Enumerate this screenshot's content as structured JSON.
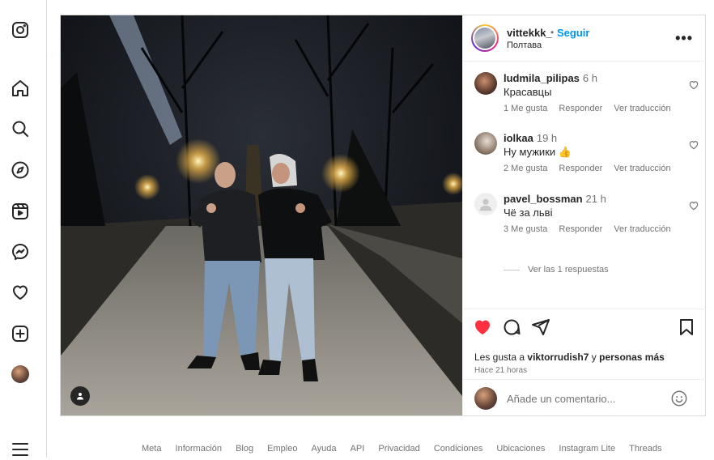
{
  "sidebar": {
    "items": [
      {
        "name": "instagram-logo-icon"
      },
      {
        "name": "home-icon"
      },
      {
        "name": "search-icon"
      },
      {
        "name": "explore-icon"
      },
      {
        "name": "reels-icon"
      },
      {
        "name": "messenger-icon"
      },
      {
        "name": "notifications-heart-icon"
      },
      {
        "name": "create-icon"
      },
      {
        "name": "profile-avatar"
      },
      {
        "name": "menu-icon"
      }
    ]
  },
  "post": {
    "header": {
      "username": "vittekkk_",
      "separator": "•",
      "follow_label": "Seguir",
      "location": "Полтава",
      "more_label": "•••"
    },
    "comments": [
      {
        "user": "ludmila_pilipas",
        "time": "6 h",
        "text": "Красавцы",
        "likes": "1 Me gusta",
        "reply": "Responder",
        "translate": "Ver traducción"
      },
      {
        "user": "iolkaa",
        "time": "19 h",
        "text": "Ну мужики 👍",
        "likes": "2 Me gusta",
        "reply": "Responder",
        "translate": "Ver traducción"
      },
      {
        "user": "pavel_bossman",
        "time": "21 h",
        "text": "Чё за льві",
        "likes": "3 Me gusta",
        "reply": "Responder",
        "translate": "Ver traducción"
      }
    ],
    "view_replies": "Ver las 1 respuestas",
    "likes_prefix": "Les gusta a",
    "likes_user": "viktorrudish7",
    "likes_and": "y",
    "likes_others": "personas más",
    "time_ago": "Hace 21 horas",
    "add_comment_placeholder": "Añade un comentario..."
  },
  "footer": {
    "links": [
      "Meta",
      "Información",
      "Blog",
      "Empleo",
      "Ayuda",
      "API",
      "Privacidad",
      "Condiciones",
      "Ubicaciones",
      "Instagram Lite",
      "Threads"
    ]
  },
  "colors": {
    "accent": "#0095f6",
    "like": "#ff3040",
    "text": "#262626",
    "muted": "#737373"
  }
}
